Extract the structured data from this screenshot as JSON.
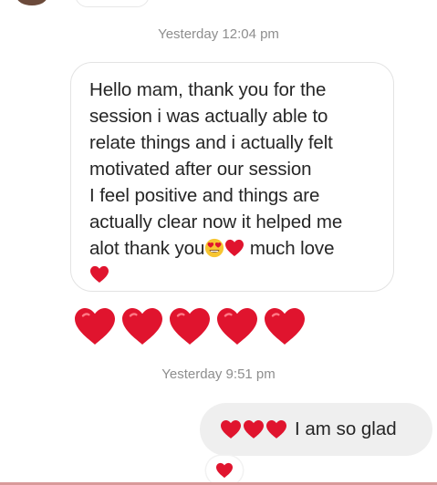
{
  "timestamps": {
    "first": "Yesterday 12:04 pm",
    "second": "Yesterday 9:51 pm"
  },
  "incoming_message": {
    "lines": [
      "Hello mam, thank you for the",
      "session i was actually able to",
      "relate things and i actually felt",
      "motivated after our session",
      "I feel positive and things are",
      "actually clear now it helped me"
    ],
    "last_line_start": "alot thank you",
    "last_line_end": " much love",
    "emojis": [
      "heart-eyes-face",
      "red-heart",
      "red-heart"
    ]
  },
  "hearts_message": {
    "emoji": "red-heart",
    "count": 5
  },
  "outgoing_message": {
    "text": "I am so glad",
    "heart_emoji_count": 3,
    "bubble_color": "#efefef"
  },
  "reaction": {
    "emoji": "red-heart"
  },
  "colors": {
    "heart": "#e0142e",
    "timestamp": "#8e8e8e",
    "text": "#262626"
  }
}
